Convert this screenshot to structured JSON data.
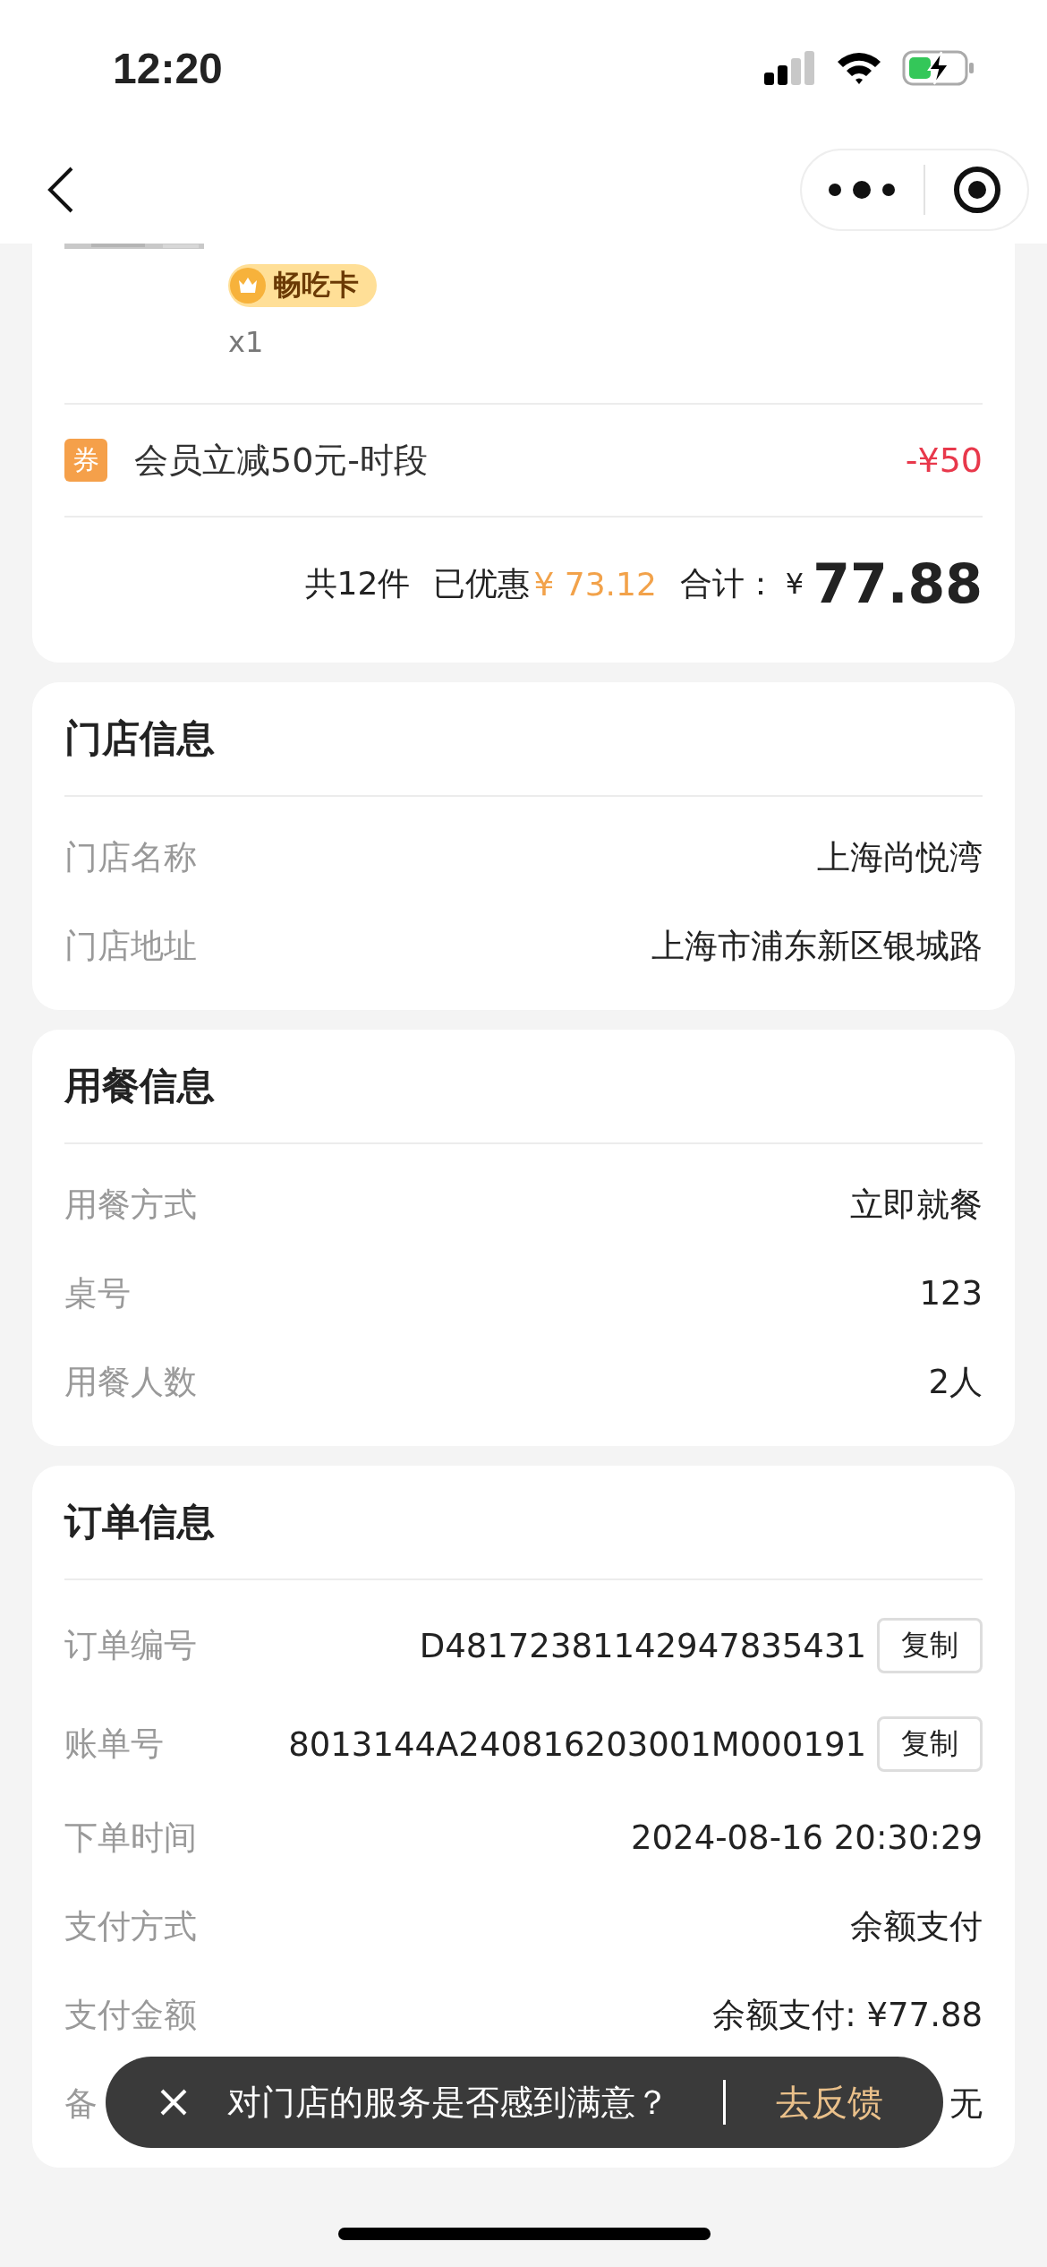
{
  "status_bar": {
    "time": "12:20"
  },
  "order_item": {
    "badge": "畅吃卡",
    "quantity": "x1"
  },
  "discount": {
    "icon_text": "券",
    "label": "会员立减50元-时段",
    "amount": "-¥50"
  },
  "summary": {
    "count": "共12件",
    "saved_label": "已优惠",
    "saved_amount": "¥ 73.12",
    "total_label": "合计：",
    "currency": "¥",
    "total": "77.88"
  },
  "sections": [
    {
      "title": "门店信息",
      "rows": [
        {
          "label": "门店名称",
          "value": "上海尚悦湾"
        },
        {
          "label": "门店地址",
          "value": "上海市浦东新区银城路"
        }
      ]
    },
    {
      "title": "用餐信息",
      "rows": [
        {
          "label": "用餐方式",
          "value": "立即就餐"
        },
        {
          "label": "桌号",
          "value": "123"
        },
        {
          "label": "用餐人数",
          "value": "2人"
        }
      ]
    },
    {
      "title": "订单信息",
      "rows": [
        {
          "label": "订单编号",
          "value": "D48172381142947835431",
          "button": "复制"
        },
        {
          "label": "账单号",
          "value": "8013144A240816203001M000191",
          "button": "复制"
        },
        {
          "label": "下单时间",
          "value": "2024-08-16 20:30:29"
        },
        {
          "label": "支付方式",
          "value": "余额支付"
        },
        {
          "label": "支付金额",
          "value": "余额支付: ¥77.88"
        },
        {
          "label_parts": [
            "备"
          ],
          "value": "无"
        }
      ]
    }
  ],
  "toast": {
    "message": "对门店的服务是否感到满意？",
    "action": "去反馈"
  }
}
